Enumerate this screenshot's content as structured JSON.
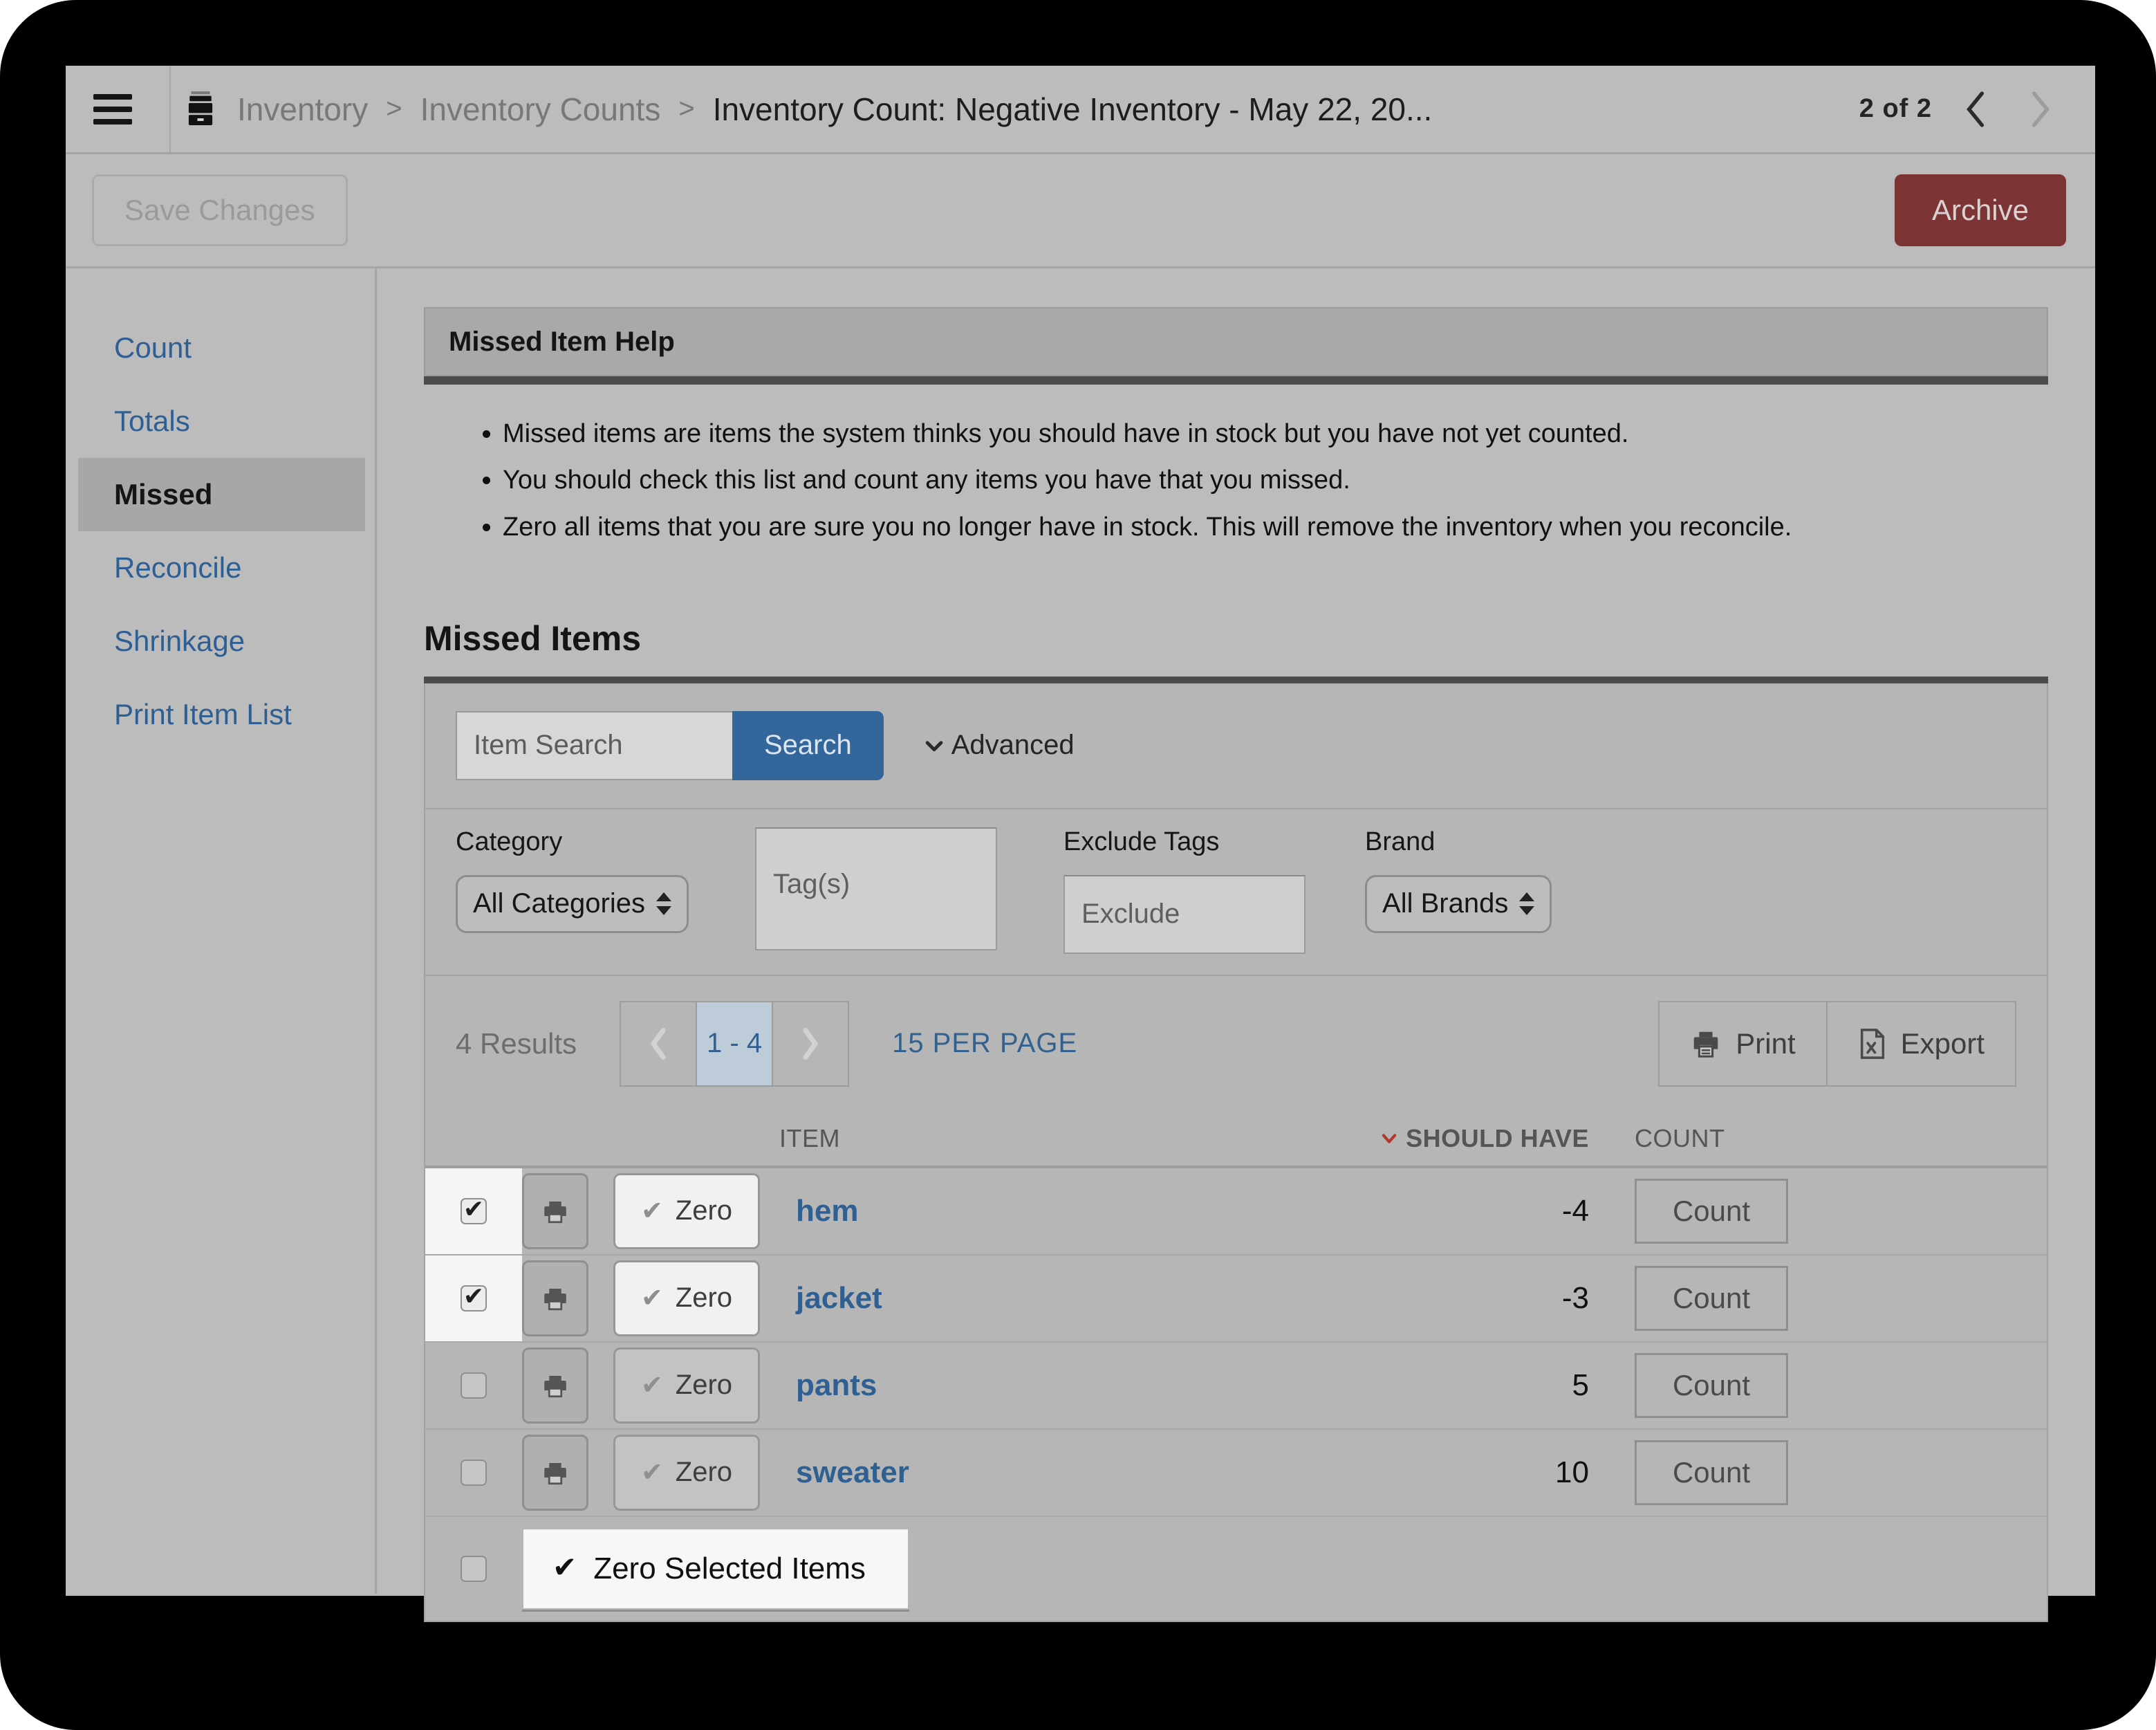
{
  "header": {
    "breadcrumb": [
      "Inventory",
      "Inventory Counts"
    ],
    "separator": ">",
    "title": "Inventory Count: Negative Inventory - May 22, 20...",
    "pager": "2 of 2"
  },
  "toolbar": {
    "save": "Save Changes",
    "archive": "Archive"
  },
  "sidebar": {
    "items": [
      {
        "label": "Count",
        "active": false
      },
      {
        "label": "Totals",
        "active": false
      },
      {
        "label": "Missed",
        "active": true
      },
      {
        "label": "Reconcile",
        "active": false
      },
      {
        "label": "Shrinkage",
        "active": false
      },
      {
        "label": "Print Item List",
        "active": false
      }
    ]
  },
  "help": {
    "title": "Missed Item Help",
    "bullets": [
      "Missed items are items the system thinks you should have in stock but you have not yet counted.",
      "You should check this list and count any items you have that you missed.",
      "Zero all items that you are sure you no longer have in stock. This will remove the inventory when you reconcile."
    ]
  },
  "section": {
    "heading": "Missed Items"
  },
  "search": {
    "placeholder": "Item Search",
    "button": "Search",
    "advanced": "Advanced"
  },
  "filters": {
    "category_label": "Category",
    "category_value": "All Categories",
    "tags_placeholder": "Tag(s)",
    "exclude_label": "Exclude Tags",
    "exclude_placeholder": "Exclude",
    "brand_label": "Brand",
    "brand_value": "All Brands"
  },
  "results": {
    "count": "4 Results",
    "range": "1 - 4",
    "per_page": "15 PER PAGE",
    "print": "Print",
    "export": "Export"
  },
  "table": {
    "headers": {
      "item": "ITEM",
      "should_have": "SHOULD HAVE",
      "count": "COUNT"
    },
    "zero_label": "Zero",
    "count_label": "Count",
    "rows": [
      {
        "item": "hem",
        "should_have": "-4",
        "checked": true
      },
      {
        "item": "jacket",
        "should_have": "-3",
        "checked": true
      },
      {
        "item": "pants",
        "should_have": "5",
        "checked": false
      },
      {
        "item": "sweater",
        "should_have": "10",
        "checked": false
      }
    ],
    "zero_selected": "Zero Selected Items"
  },
  "icons": {
    "hamburger": "css-bars",
    "inventory_box": "svg-archive-box",
    "prev_chevron": "svg-chevron-left",
    "next_chevron": "svg-chevron-right",
    "advanced_chevron": "svg-chevron-down",
    "sort_chevron": "svg-chevron-down-red",
    "printer": "svg-printer",
    "export_doc": "svg-document-x",
    "check": "✔",
    "select_updown": "css-triangles"
  },
  "colors": {
    "accent_blue": "#33679c",
    "link_blue": "#2e6093",
    "archive_red": "#7c3434",
    "sort_red": "#b0392e",
    "highlight": "#f5f5f5",
    "dark_bar": "#4c4c4c"
  }
}
